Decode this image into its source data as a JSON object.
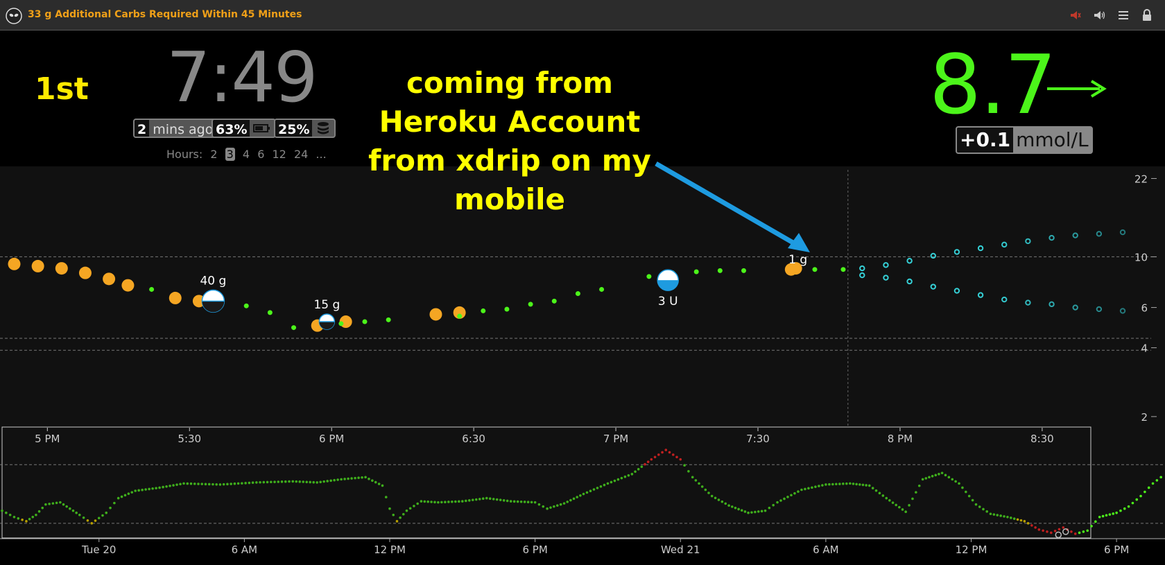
{
  "topbar": {
    "alarm_text": "33 g Additional Carbs Required Within 45 Minutes",
    "icons": [
      "alien-logo-icon",
      "alarm-muted-icon",
      "speaker-icon",
      "menu-icon",
      "lock-icon"
    ]
  },
  "header": {
    "place": "1st",
    "time": "7:49",
    "mins_ago": {
      "value": "2",
      "unit": "mins ago"
    },
    "phone_battery": {
      "value": "63%"
    },
    "pump_reservoir": {
      "value": "25%"
    },
    "hours": {
      "label": "Hours:",
      "options": [
        "2",
        "3",
        "4",
        "6",
        "12",
        "24",
        "..."
      ],
      "selected": "3"
    },
    "annotation": [
      "coming from",
      "Heroku Account",
      "from xdrip on my",
      "mobile"
    ],
    "bg": "8.7",
    "delta": {
      "value": "+0.1",
      "unit": "mmol/L"
    }
  },
  "colors": {
    "bg": "#4cf51a",
    "alarm": "#f0a018",
    "annotation": "#ffff00",
    "arrow": "#1e9be0",
    "cgm": "#4cf51a",
    "orange": "#f5a623",
    "cyan": "#35d0d6",
    "red": "#c02020"
  },
  "chart_data": [
    {
      "type": "scatter",
      "name": "main",
      "title": "",
      "xlabel": "",
      "ylabel": "",
      "y_ticks": [
        22,
        10,
        6,
        4,
        2
      ],
      "x_ticks": [
        "5 PM",
        "5:30",
        "6 PM",
        "6:30",
        "7 PM",
        "7:30",
        "8 PM",
        "8:30"
      ],
      "x_tick_minutes": [
        0,
        30,
        60,
        90,
        120,
        150,
        180,
        210
      ],
      "x_range_minutes": [
        -10,
        233
      ],
      "y_scale": "log",
      "ylim": [
        1.8,
        24
      ],
      "thresholds": [
        10,
        4.4,
        3.9
      ],
      "now_minutes": 169,
      "cgm_points": [
        {
          "t": 22,
          "y": 7.2
        },
        {
          "t": 42,
          "y": 6.1
        },
        {
          "t": 47,
          "y": 5.7
        },
        {
          "t": 52,
          "y": 4.9
        },
        {
          "t": 62,
          "y": 5.1
        },
        {
          "t": 67,
          "y": 5.2
        },
        {
          "t": 72,
          "y": 5.3
        },
        {
          "t": 87,
          "y": 5.5
        },
        {
          "t": 92,
          "y": 5.8
        },
        {
          "t": 97,
          "y": 5.9
        },
        {
          "t": 102,
          "y": 6.2
        },
        {
          "t": 107,
          "y": 6.4
        },
        {
          "t": 112,
          "y": 6.9
        },
        {
          "t": 117,
          "y": 7.2
        },
        {
          "t": 127,
          "y": 8.2
        },
        {
          "t": 132,
          "y": 8.5
        },
        {
          "t": 137,
          "y": 8.6
        },
        {
          "t": 142,
          "y": 8.7
        },
        {
          "t": 147,
          "y": 8.7
        },
        {
          "t": 162,
          "y": 8.8
        },
        {
          "t": 168,
          "y": 8.8
        }
      ],
      "mbg_points": [
        {
          "t": -7,
          "y": 9.3
        },
        {
          "t": -2,
          "y": 9.1
        },
        {
          "t": 3,
          "y": 8.9
        },
        {
          "t": 8,
          "y": 8.5
        },
        {
          "t": 13,
          "y": 8.0
        },
        {
          "t": 17,
          "y": 7.5
        },
        {
          "t": 27,
          "y": 6.6
        },
        {
          "t": 32,
          "y": 6.4
        },
        {
          "t": 57,
          "y": 5.0
        },
        {
          "t": 82,
          "y": 5.6
        },
        {
          "t": 87,
          "y": 5.7
        },
        {
          "t": 63,
          "y": 5.2
        },
        {
          "t": 157,
          "y": 8.8
        }
      ],
      "treatments": [
        {
          "t": 35,
          "y": 6.4,
          "label": "40 g",
          "kind": "carbs"
        },
        {
          "t": 59,
          "y": 5.2,
          "label": "15 g",
          "kind": "carbs"
        },
        {
          "t": 131,
          "y": 7.9,
          "label": "3 U",
          "kind": "insulin"
        },
        {
          "t": 158,
          "y": 8.9,
          "label": "1 g",
          "kind": "carbs-small"
        }
      ],
      "forecast_upper": [
        {
          "t": 172,
          "y": 8.9
        },
        {
          "t": 177,
          "y": 9.2
        },
        {
          "t": 182,
          "y": 9.6
        },
        {
          "t": 187,
          "y": 10.1
        },
        {
          "t": 192,
          "y": 10.5
        },
        {
          "t": 197,
          "y": 10.9
        },
        {
          "t": 202,
          "y": 11.3
        },
        {
          "t": 207,
          "y": 11.7
        },
        {
          "t": 212,
          "y": 12.1
        },
        {
          "t": 217,
          "y": 12.4
        },
        {
          "t": 222,
          "y": 12.6
        },
        {
          "t": 227,
          "y": 12.8
        }
      ],
      "forecast_lower": [
        {
          "t": 172,
          "y": 8.3
        },
        {
          "t": 177,
          "y": 8.1
        },
        {
          "t": 182,
          "y": 7.8
        },
        {
          "t": 187,
          "y": 7.4
        },
        {
          "t": 192,
          "y": 7.1
        },
        {
          "t": 197,
          "y": 6.8
        },
        {
          "t": 202,
          "y": 6.5
        },
        {
          "t": 207,
          "y": 6.3
        },
        {
          "t": 212,
          "y": 6.2
        },
        {
          "t": 217,
          "y": 6.0
        },
        {
          "t": 222,
          "y": 5.9
        },
        {
          "t": 227,
          "y": 5.8
        }
      ]
    },
    {
      "type": "line",
      "name": "overview",
      "title": "",
      "x_ticks": [
        "Tue 20",
        "6 AM",
        "12 PM",
        "6 PM",
        "Wed 21",
        "6 AM",
        "12 PM",
        "6 PM"
      ],
      "x_tick_hours": [
        0,
        6,
        12,
        18,
        24,
        30,
        36,
        42
      ],
      "x_range_hours": [
        -4,
        44
      ],
      "thresholds": [
        10,
        4.4
      ],
      "ylim": [
        3.0,
        12.0
      ],
      "points": [
        [
          -4,
          5.6
        ],
        [
          -3.5,
          5.0
        ],
        [
          -3,
          4.6
        ],
        [
          -2.6,
          5.2
        ],
        [
          -2.2,
          6.2
        ],
        [
          -1.6,
          6.4
        ],
        [
          -1.2,
          5.8
        ],
        [
          -0.8,
          5.2
        ],
        [
          -0.3,
          4.4
        ],
        [
          0.3,
          5.4
        ],
        [
          0.8,
          6.8
        ],
        [
          1.5,
          7.5
        ],
        [
          2.5,
          7.8
        ],
        [
          3.5,
          8.2
        ],
        [
          5.0,
          8.1
        ],
        [
          6.5,
          8.3
        ],
        [
          8.0,
          8.4
        ],
        [
          9.0,
          8.3
        ],
        [
          10.0,
          8.6
        ],
        [
          11.0,
          8.8
        ],
        [
          11.7,
          8.0
        ],
        [
          12.0,
          5.8
        ],
        [
          12.3,
          4.6
        ],
        [
          12.7,
          5.6
        ],
        [
          13.3,
          6.5
        ],
        [
          14.0,
          6.4
        ],
        [
          15.0,
          6.5
        ],
        [
          16.0,
          6.8
        ],
        [
          17.0,
          6.5
        ],
        [
          18.0,
          6.4
        ],
        [
          18.5,
          5.8
        ],
        [
          19.2,
          6.3
        ],
        [
          20.0,
          7.2
        ],
        [
          21.0,
          8.2
        ],
        [
          22.0,
          9.1
        ],
        [
          22.8,
          10.5
        ],
        [
          23.4,
          11.4
        ],
        [
          24.0,
          10.5
        ],
        [
          24.5,
          8.8
        ],
        [
          25.3,
          7.0
        ],
        [
          26.0,
          6.1
        ],
        [
          26.8,
          5.4
        ],
        [
          27.5,
          5.6
        ],
        [
          28.0,
          6.4
        ],
        [
          29.0,
          7.6
        ],
        [
          30.0,
          8.1
        ],
        [
          31.0,
          8.2
        ],
        [
          31.8,
          8.0
        ],
        [
          32.5,
          6.8
        ],
        [
          33.3,
          5.5
        ],
        [
          34.0,
          8.6
        ],
        [
          34.8,
          9.2
        ],
        [
          35.5,
          8.2
        ],
        [
          36.2,
          6.2
        ],
        [
          36.8,
          5.3
        ],
        [
          37.5,
          5.0
        ],
        [
          38.2,
          4.6
        ],
        [
          38.8,
          3.8
        ],
        [
          39.3,
          3.5
        ],
        [
          39.8,
          4.0
        ],
        [
          40.3,
          3.4
        ],
        [
          40.8,
          3.7
        ],
        [
          41.3,
          5.0
        ],
        [
          42.0,
          5.4
        ],
        [
          42.5,
          6.0
        ],
        [
          43.0,
          7.0
        ],
        [
          43.5,
          8.2
        ],
        [
          44.0,
          9.1
        ]
      ],
      "brush_hours": [
        39.3,
        44
      ]
    }
  ]
}
